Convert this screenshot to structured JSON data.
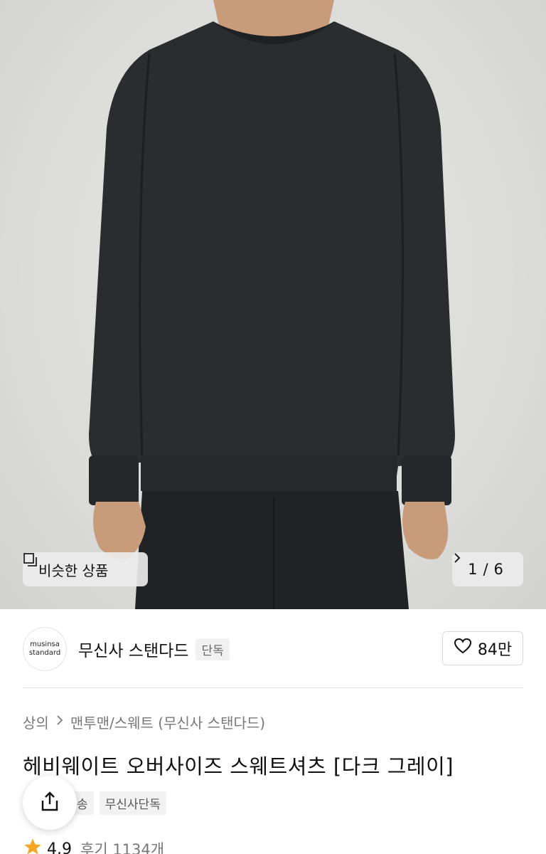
{
  "hero": {
    "similar_label": "비슷한 상품",
    "pager_current": "1",
    "pager_sep": "/",
    "pager_total": "6"
  },
  "brand": {
    "logo_line1": "musinsa",
    "logo_line2": "standard",
    "name": "무신사 스탠다드",
    "badge": "단독",
    "likes": "84만"
  },
  "breadcrumb": {
    "root": "상의",
    "category": "맨투맨/스웨트 (무신사 스탠다드)"
  },
  "product": {
    "title": "헤비웨이트 오버사이즈 스웨트셔츠 [다크 그레이]",
    "tags": [
      "송",
      "무신사단독"
    ],
    "rating": "4.9",
    "review_label": "후기 1134개"
  },
  "colors": {
    "star": "#f5a623",
    "shirt": "#2a2c2e"
  },
  "icons": [
    "similar-products-icon",
    "chevron-right-icon",
    "heart-icon",
    "share-icon",
    "star-icon"
  ]
}
